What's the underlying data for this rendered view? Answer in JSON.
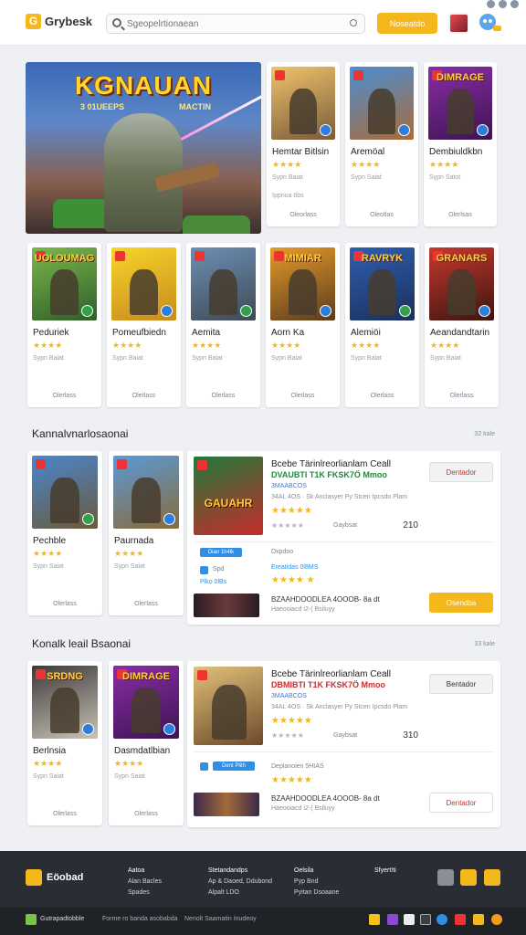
{
  "header": {
    "logo_text": "Grybesk",
    "search_placeholder": "Sgeopelrtionaean",
    "action_button": "Noseatdo"
  },
  "hero": {
    "title": "KGNAUAN",
    "subtitle_left": "3 01UEEPS",
    "subtitle_right": "MACTIN"
  },
  "featured_cards": [
    {
      "name": "Hemtar Bitlsin",
      "stars": "★★★★",
      "meta": "Sypn Baiat",
      "meta2": "Ippnoa 6bs",
      "foot": "Oleorlass",
      "title_art": "",
      "colors": [
        "#f0c36b",
        "#7a5b3a"
      ]
    },
    {
      "name": "Aremöal",
      "stars": "★★★★",
      "meta": "Sypn Saiat",
      "meta2": "",
      "foot": "Oleotlas",
      "title_art": "",
      "colors": [
        "#4b8ed2",
        "#a96b3b"
      ]
    },
    {
      "name": "Dembiuldkbn",
      "stars": "★★★★",
      "meta": "Sypn Satot",
      "meta2": "",
      "foot": "Olerlsas",
      "title_art": "DIMRAGE",
      "colors": [
        "#8b2ca8",
        "#3c1450"
      ]
    }
  ],
  "grid_cards": [
    {
      "name": "Peduriek",
      "stars": "★★★★",
      "meta": "Sypn Baiat",
      "foot": "Olerlass",
      "title_art": "UOLOUMAG",
      "colors": [
        "#7bb84a",
        "#2f5e2a"
      ]
    },
    {
      "name": "Pomeufbiedn",
      "stars": "★★★★",
      "meta": "Sypn Baiat",
      "foot": "Olerlass",
      "title_art": "",
      "colors": [
        "#f6d52a",
        "#c98a1d"
      ]
    },
    {
      "name": "Aemita",
      "stars": "★★★★",
      "meta": "Sypn Baiat",
      "foot": "Olerlass",
      "title_art": "",
      "colors": [
        "#6d8fb5",
        "#3e4a55"
      ]
    },
    {
      "name": "Aorn Ka",
      "stars": "★★★★",
      "meta": "Sypn Baiat",
      "foot": "Olerlass",
      "title_art": "MIMIAR",
      "colors": [
        "#e69a2a",
        "#5b3b1d"
      ]
    },
    {
      "name": "Alemiöi",
      "stars": "★★★★",
      "meta": "Sypn Baiat",
      "foot": "Olerlass",
      "title_art": "RAVRYK",
      "colors": [
        "#2e5fb0",
        "#1c2f5c"
      ]
    },
    {
      "name": "Aeandandtarin",
      "stars": "★★★★",
      "meta": "Sypn Baiat",
      "foot": "Olerlass",
      "title_art": "GRANARS",
      "colors": [
        "#c6392d",
        "#3d1410"
      ]
    }
  ],
  "section1": {
    "title": "Kannalvnarlosaonai",
    "count": "32 kale",
    "cards": [
      {
        "name": "Pechble",
        "stars": "★★★★",
        "meta": "Sypn Saiat",
        "foot": "Olerlass",
        "colors": [
          "#4a86d0",
          "#6b5a3a"
        ]
      },
      {
        "name": "Paurnada",
        "stars": "★★★★",
        "meta": "Sypn Saiat",
        "foot": "Olerlass",
        "colors": [
          "#5a9ad8",
          "#8a6a3a"
        ]
      }
    ],
    "panel": {
      "title": "Bcebe Tärinlreorlianlam Ceall",
      "subtitle": "DVAUBTI T1K FKSK7Ö Mmoo",
      "line": "3MAABCOS",
      "desc": "34AL 4OS · Sk Anclasyer Py Stcen Ipcsdo Plam",
      "stars": "★★★★★",
      "gray_stars": "★★★★★",
      "label": "Gaybsat",
      "number": "210",
      "button": "Dentador",
      "art_title": "GAUAHR",
      "chip": "Dian 1h4lk",
      "chip_label": "Dxpdoo",
      "item_label": "Spd",
      "item_sub": "Plko 0lBs",
      "item_blue": "Ereatidas 0l8MS",
      "item_stars": "★★★★ ★",
      "strip_title": "BZAAHDOODLEA 4OOOB- 8a dt",
      "strip_sub": "Haeooiacd i2-( Bsiluyy",
      "strip_button": "Osendba"
    }
  },
  "section2": {
    "title": "Konalk leail Bsaonai",
    "count": "33 kale",
    "cards": [
      {
        "name": "Berlnsia",
        "stars": "★★★★",
        "meta": "Sypn Saiat",
        "foot": "Olerlass",
        "title_art": "SRDNG",
        "colors": [
          "#3e3a3a",
          "#c8c2b6"
        ]
      },
      {
        "name": "Dasmdatlbian",
        "stars": "★★★★",
        "meta": "Sypn Saiat",
        "foot": "Olerlass",
        "title_art": "DIMRAGE",
        "colors": [
          "#8b2ca8",
          "#3c1450"
        ]
      }
    ],
    "panel": {
      "title": "Bcebe Tärinlreorlianlam Ceall",
      "subtitle": "DBMIBTI T1K FKSK7Ö Mmoo",
      "line": "3MAABCOS",
      "desc": "34AL 4OS · Sk Anclasyer Py Stcen Ipcsdo Plam",
      "stars": "★★★★★",
      "gray_stars": "★★★★★",
      "label": "Gaybsat",
      "number": "310",
      "button": "Bentador",
      "chip": "Dent Plith",
      "chip_label": "Deplanoien 5HIAS",
      "item_stars": "★★★★★",
      "strip_title": "BZAAHDOODLEA 4OOOB- 8a dt",
      "strip_sub": "Haeooiacd i2-( Bsiluyy",
      "strip_button": "Dentador"
    }
  },
  "footer": {
    "logo": "Eöobad",
    "col1": {
      "h": "Aatoa",
      "a": "Alan Bacles",
      "b": "Spades"
    },
    "col2": {
      "h": "Stetandandps",
      "a": "Ap & Daoed, Ddubond",
      "b": "Alpalt LDO"
    },
    "col3": {
      "h": "Oelsila",
      "a": "Pyp Bnd",
      "b": "Pyitan Dsoaane"
    },
    "col4": {
      "h": "Sfyert!ti"
    },
    "bottom_left": "Gutrapadtobble",
    "bottom_mid1": "Forme ro banda asobabda",
    "bottom_mid2": "Nenolt Saamatin Inudeoy"
  }
}
